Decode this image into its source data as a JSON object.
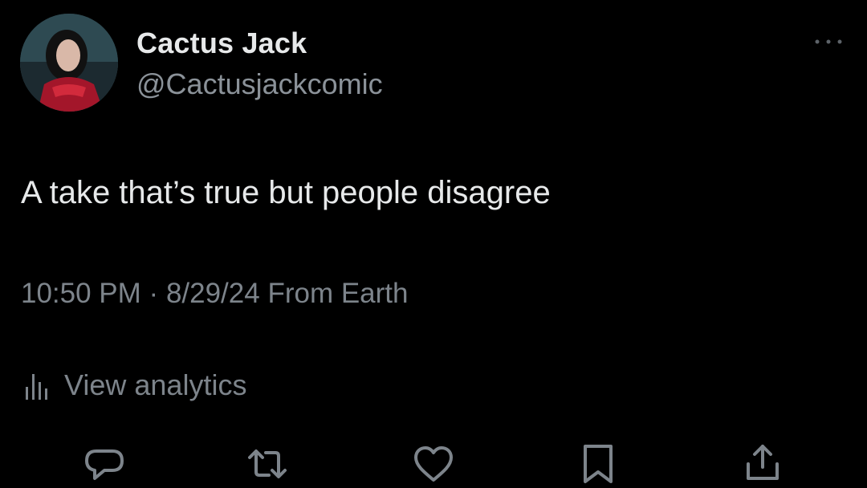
{
  "tweet": {
    "author": {
      "display_name": "Cactus Jack",
      "handle": "@Cactusjackcomic"
    },
    "text": "A take that’s true but people disagree",
    "time": "10:50 PM",
    "separator": "·",
    "date": "8/29/24",
    "source": "From Earth",
    "analytics_label": "View analytics"
  },
  "icons": {
    "more": "more-horizontal-icon",
    "analytics": "bar-chart-icon",
    "reply": "reply-icon",
    "retweet": "retweet-icon",
    "like": "heart-icon",
    "bookmark": "bookmark-icon",
    "share": "share-icon"
  },
  "colors": {
    "background": "#000000",
    "primary_text": "#e7e9ea",
    "secondary_text": "#7d848b"
  }
}
